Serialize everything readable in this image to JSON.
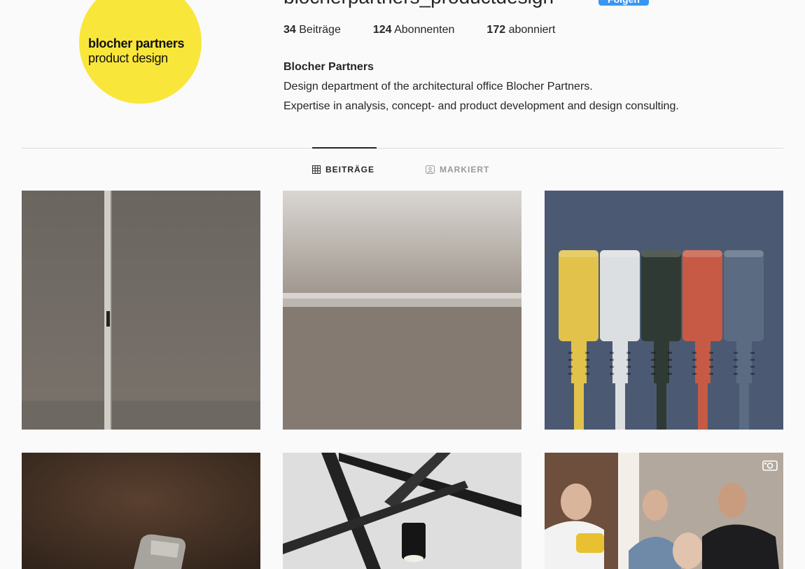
{
  "profile": {
    "avatar_line1": "blocher partners",
    "avatar_line2": "product design",
    "username": "blocherpartners_productdesign",
    "follow_label": "Folgen"
  },
  "stats": {
    "posts_count": "34",
    "posts_label": "Beiträge",
    "followers_count": "124",
    "followers_label": "Abonnenten",
    "following_count": "172",
    "following_label": "abonniert"
  },
  "bio": {
    "name": "Blocher Partners",
    "line1": "Design department of the architectural office Blocher Partners.",
    "line2": "Expertise in analysis, concept- and product development and design consulting."
  },
  "tabs": {
    "posts": "BEITRÄGE",
    "tagged": "MARKIERT"
  },
  "grid": {
    "icons": [
      "grid-icon",
      "tagged-icon",
      "video-icon"
    ],
    "cable_colors": [
      "#e2c24a",
      "#dcdfe2",
      "#2f3a34",
      "#c65a45",
      "#5b6c82"
    ]
  }
}
